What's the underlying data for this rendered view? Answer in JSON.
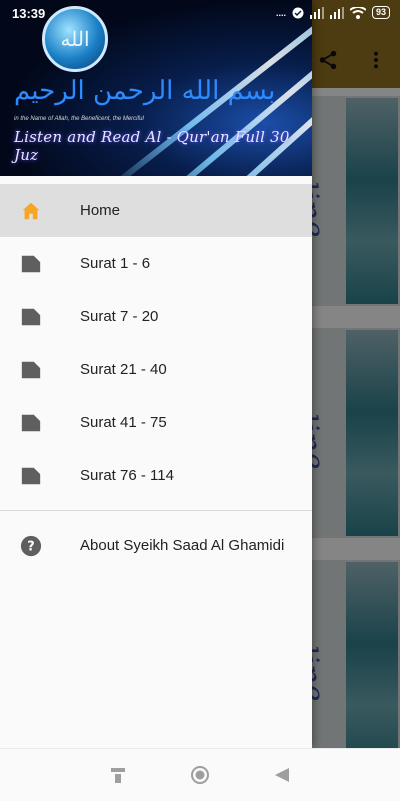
{
  "status_bar": {
    "time": "13:39",
    "battery": "93",
    "signal_text": "...."
  },
  "header": {
    "emblem_text": "الله",
    "bismillah": "بسم الله الرحمن الرحيم",
    "names_line": "in the Name of Allah, the Beneficent, the Merciful",
    "title": "Listen and Read Al - Qur'an Full 30 Juz"
  },
  "menu": {
    "items": [
      {
        "label": "Home",
        "icon": "home-icon",
        "active": true
      },
      {
        "label": "Surat 1 - 6",
        "icon": "file-icon"
      },
      {
        "label": "Surat 7 - 20",
        "icon": "file-icon"
      },
      {
        "label": "Surat 21 - 40",
        "icon": "file-icon"
      },
      {
        "label": "Surat 41 - 75",
        "icon": "file-icon"
      },
      {
        "label": "Surat 76 - 114",
        "icon": "file-icon"
      }
    ],
    "about": {
      "label": "About Syeikh Saad Al Ghamidi",
      "icon": "help-icon"
    }
  },
  "colors": {
    "home_icon": "#f5a623",
    "file_icon": "#5f5f5f",
    "active_bg": "#dedede",
    "toolbar": "#8d6c1f"
  },
  "background_cards": {
    "script_text": "Online"
  }
}
